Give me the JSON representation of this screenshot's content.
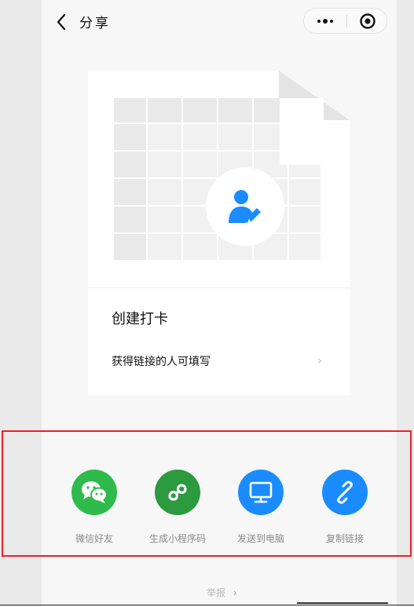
{
  "header": {
    "title": "分享",
    "back_icon": "chevron-left-icon",
    "more_icon": "more-dots-icon",
    "close_icon": "target-circle-icon"
  },
  "card": {
    "title": "创建打卡",
    "subtitle": "获得链接的人可填写",
    "arrow": "›",
    "center_icon": "user-edit-icon",
    "accent": "#1a8cff"
  },
  "share": [
    {
      "label": "微信好友",
      "icon": "wechat-icon",
      "color": "#2fbb4b"
    },
    {
      "label": "生成小程序码",
      "icon": "mini-program-icon",
      "color": "#2c9a3e"
    },
    {
      "label": "发送到电脑",
      "icon": "monitor-icon",
      "color": "#1a8cff"
    },
    {
      "label": "复制链接",
      "icon": "link-icon",
      "color": "#1a8cff"
    }
  ],
  "report": {
    "label": "举报",
    "arrow": "›"
  },
  "highlight_color": "#e8202a"
}
